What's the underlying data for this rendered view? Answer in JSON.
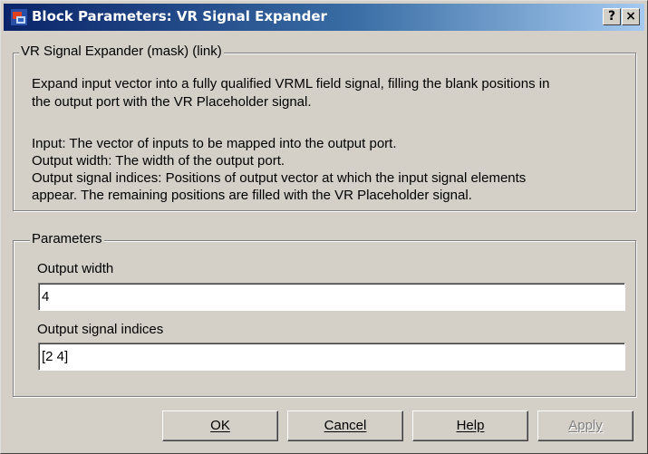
{
  "window": {
    "title": "Block Parameters: VR Signal Expander",
    "help_button": "?",
    "close_button": "×"
  },
  "mask_group": {
    "legend": "VR Signal Expander (mask) (link)",
    "lines": [
      "Expand input vector into a fully qualified VRML field signal, filling the blank positions in",
      "the output port with the VR Placeholder signal.",
      "Input: The vector of inputs to be mapped into the output port.",
      "Output width: The width of the output port.",
      "Output signal indices: Positions of output vector at which the input signal elements",
      "appear. The remaining positions are filled with the VR Placeholder signal."
    ]
  },
  "parameters": {
    "legend": "Parameters",
    "output_width_label": "Output width",
    "output_width_value": "4",
    "indices_label": "Output signal indices",
    "indices_value": "[2 4]"
  },
  "buttons": {
    "ok": "OK",
    "cancel": "Cancel",
    "help": "Help",
    "apply": "Apply"
  }
}
